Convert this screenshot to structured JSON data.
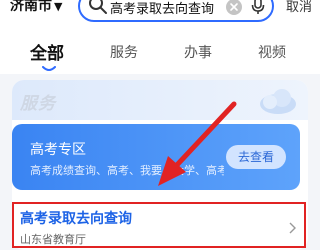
{
  "header": {
    "city": "济南市",
    "search_query": "高考录取去向查询",
    "cancel_label": "取消"
  },
  "tabs": [
    {
      "label": "全部",
      "active": true
    },
    {
      "label": "服务",
      "active": false
    },
    {
      "label": "办事",
      "active": false
    },
    {
      "label": "视频",
      "active": false
    }
  ],
  "section": {
    "title": "服务"
  },
  "banner": {
    "title": "高考专区",
    "subtitle": "高考成绩查询、高考、我要上大学、高考成...",
    "button_label": "去查看"
  },
  "result": {
    "title": "高考录取去向查询",
    "source": "山东省教育厅"
  },
  "colors": {
    "accent": "#2f6bff",
    "highlight_border": "#e12323",
    "annotation_arrow": "#e12323"
  }
}
